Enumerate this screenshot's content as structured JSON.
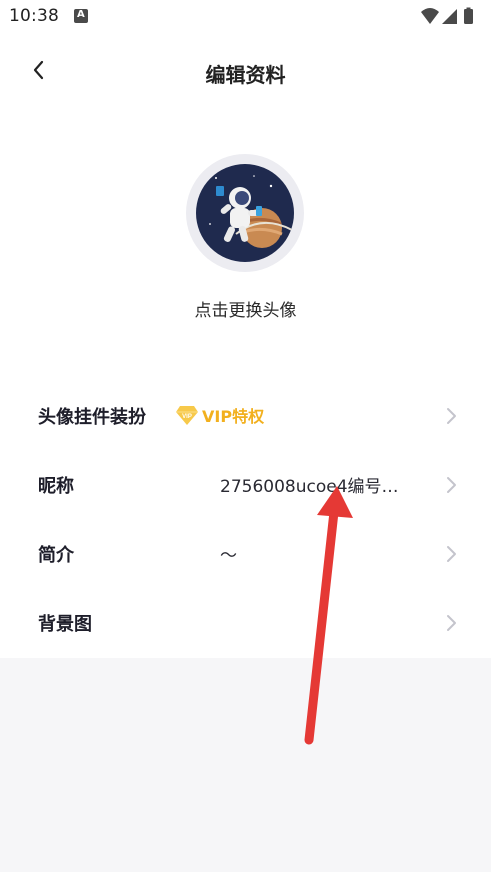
{
  "status_bar": {
    "time": "10:38",
    "notification_icon": "A",
    "icons": [
      "wifi-icon",
      "signal-icon",
      "battery-icon"
    ]
  },
  "header": {
    "title": "编辑资料",
    "back_icon": "chevron-left-icon"
  },
  "avatar": {
    "hint": "点击更换头像"
  },
  "rows": [
    {
      "label": "头像挂件装扮",
      "badge": "VIP特权"
    },
    {
      "label": "昵称",
      "value": "2756008ucoe4编号…"
    },
    {
      "label": "简介",
      "value": "～"
    },
    {
      "label": "背景图",
      "value": ""
    }
  ],
  "colors": {
    "vip": "#f2b01e",
    "annotation_arrow": "#e53935",
    "page_bg": "#f6f6f8"
  }
}
